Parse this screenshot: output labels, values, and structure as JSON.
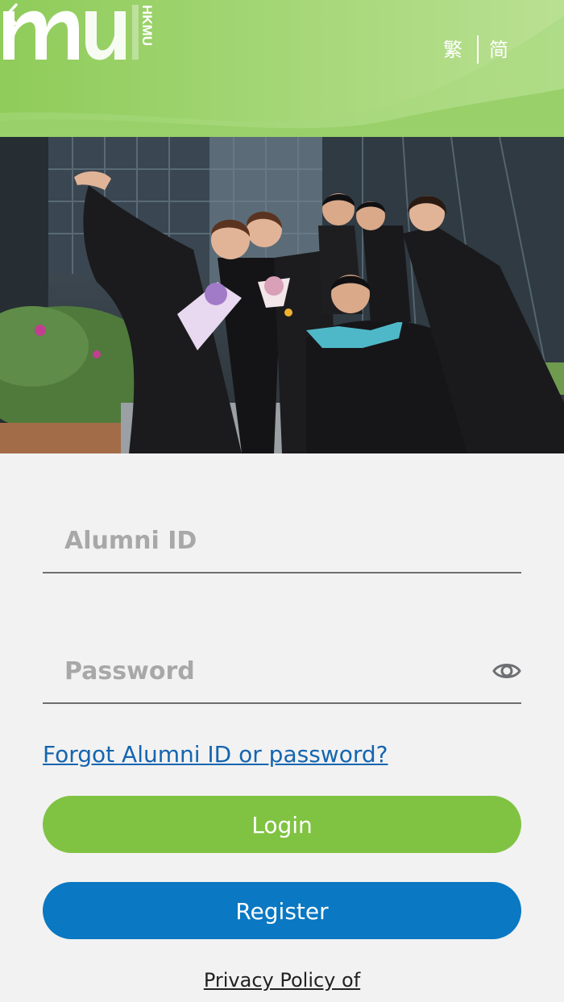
{
  "header": {
    "logo_text": "HKMU",
    "lang_traditional": "繁",
    "lang_simplified": "简",
    "back_icon": "chevron-left-icon"
  },
  "banner": {
    "image": "graduates-photo"
  },
  "form": {
    "alumni_id_placeholder": "Alumni ID",
    "password_placeholder": "Password",
    "password_toggle_icon": "eye-icon",
    "forgot_link": "Forgot Alumni ID or password?",
    "login_label": "Login",
    "register_label": "Register",
    "privacy_link": "Privacy Policy of"
  },
  "colors": {
    "header_green": "#9fd46f",
    "login_green": "#80c342",
    "register_blue": "#0a78c2",
    "link_blue": "#1565b0"
  }
}
